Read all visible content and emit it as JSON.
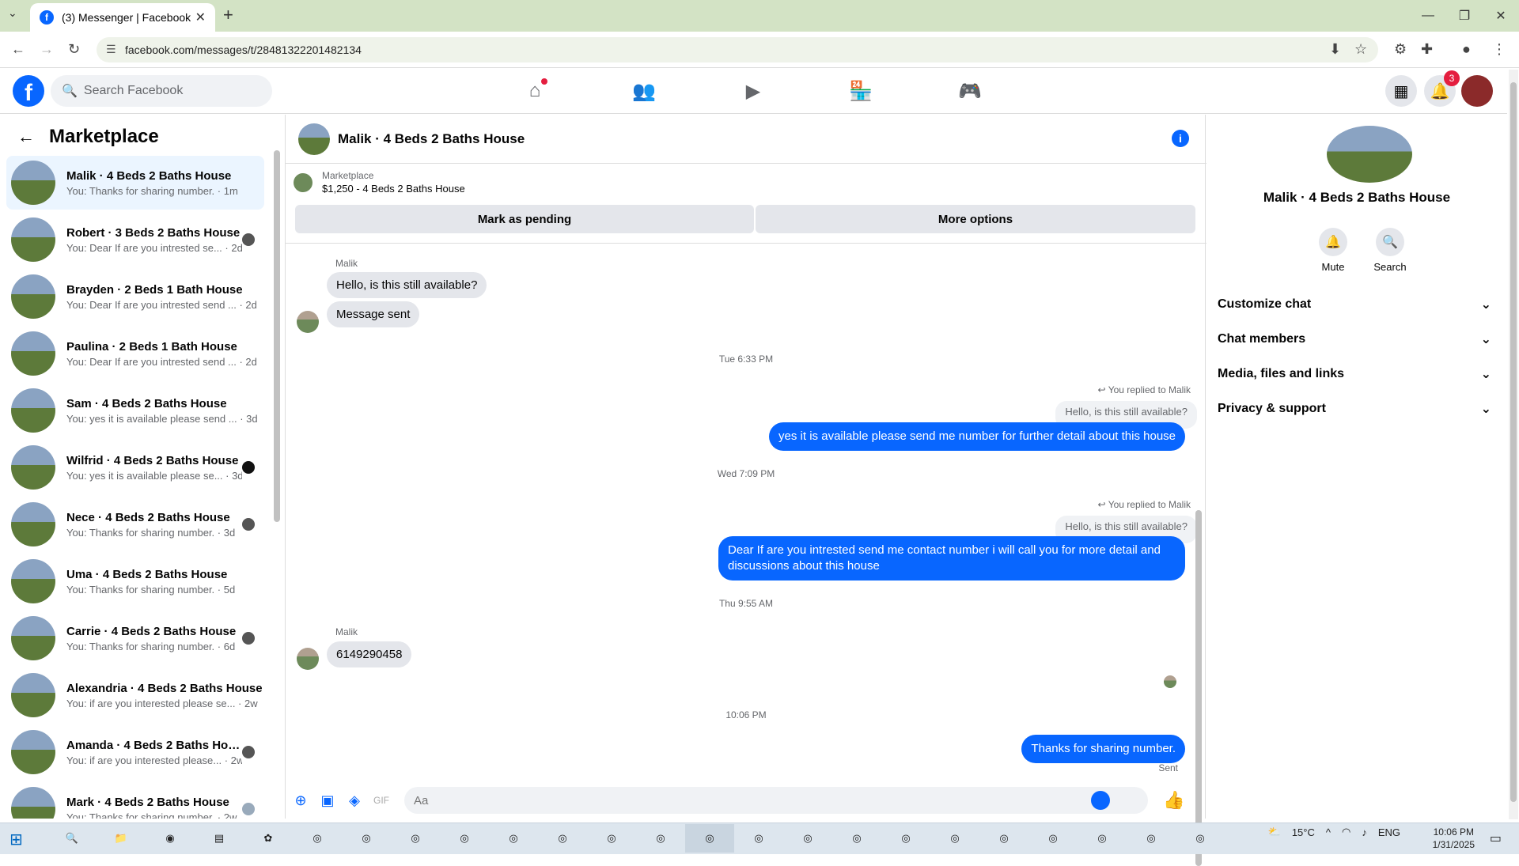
{
  "browser": {
    "tab_title": "(3) Messenger | Facebook",
    "url": "facebook.com/messages/t/28481322201482134"
  },
  "fb": {
    "search_placeholder": "Search Facebook",
    "notifications_count": "3"
  },
  "left": {
    "title": "Marketplace",
    "conversations": [
      {
        "name": "Malik · 4 Beds 2 Baths House",
        "preview": "You: Thanks for sharing number. · 1m"
      },
      {
        "name": "Robert · 3 Beds 2 Baths House",
        "preview": "You: Dear If are you intrested se... · 2d"
      },
      {
        "name": "Brayden · 2 Beds 1 Bath House",
        "preview": "You: Dear If are you intrested send ... · 2d"
      },
      {
        "name": "Paulina · 2 Beds 1 Bath House",
        "preview": "You: Dear If are you intrested send ... · 2d"
      },
      {
        "name": "Sam · 4 Beds 2 Baths House",
        "preview": "You: yes it is available please send ... · 3d"
      },
      {
        "name": "Wilfrid · 4 Beds 2 Baths House",
        "preview": "You: yes it is available please se... · 3d"
      },
      {
        "name": "Nece · 4 Beds 2 Baths House",
        "preview": "You: Thanks for sharing number. · 3d"
      },
      {
        "name": "Uma · 4 Beds 2 Baths House",
        "preview": "You: Thanks for sharing number. · 5d"
      },
      {
        "name": "Carrie · 4 Beds 2 Baths House",
        "preview": "You: Thanks for sharing number. · 6d"
      },
      {
        "name": "Alexandria · 4 Beds 2 Baths House",
        "preview": "You: if are you interested please se... · 2w"
      },
      {
        "name": "Amanda · 4 Beds 2 Baths Hou...",
        "preview": "You: if are you interested please... · 2w"
      },
      {
        "name": "Mark · 4 Beds 2 Baths House",
        "preview": "You: Thanks for sharing number. · 2w"
      }
    ]
  },
  "chat": {
    "title": "Malik · 4 Beds 2 Baths House",
    "marketplace_label": "Marketplace",
    "listing": "$1,250 - 4 Beds 2 Baths House",
    "mark_pending": "Mark as pending",
    "more_options": "More options",
    "sender_name": "Malik",
    "msg_in_1": "Hello, is this still available?",
    "msg_in_2": "Message sent",
    "ts_1": "Tue 6:33 PM",
    "replied_label": "You replied to Malik",
    "quoted": "Hello, is this still available?",
    "msg_out_1": "yes it is available please send me number for further detail about this house",
    "ts_2": "Wed 7:09 PM",
    "msg_out_2": "Dear    If are you intrested  send me contact number  i will call you for more detail and discussions about this house",
    "ts_3": "Thu 9:55 AM",
    "msg_in_3": "6149290458",
    "ts_4": "10:06 PM",
    "msg_out_3": "Thanks for sharing number.",
    "sent_label": "Sent",
    "composer_placeholder": "Aa"
  },
  "right": {
    "name": "Malik · 4 Beds 2 Baths House",
    "mute": "Mute",
    "search": "Search",
    "sections": [
      "Customize chat",
      "Chat members",
      "Media, files and links",
      "Privacy & support"
    ]
  },
  "taskbar": {
    "weather": "15°C",
    "lang": "ENG",
    "time": "10:06 PM",
    "date": "1/31/2025"
  }
}
